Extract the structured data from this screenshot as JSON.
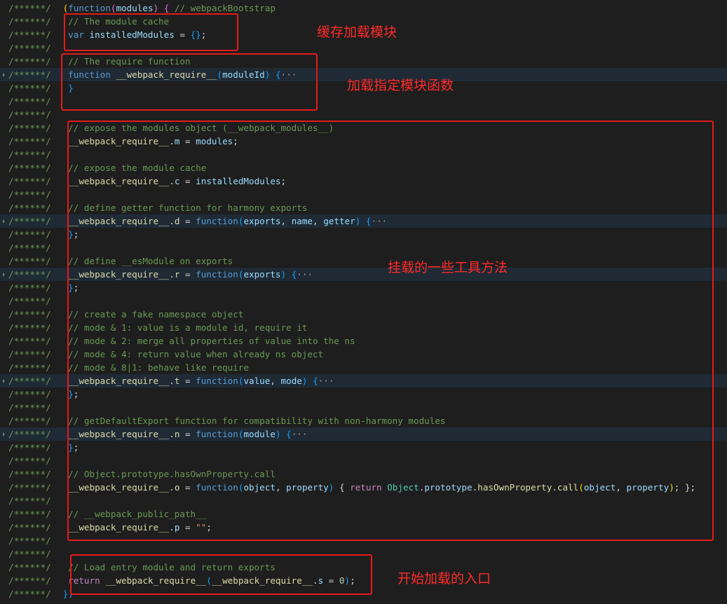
{
  "editor": {
    "gutter_marker": "/******/",
    "fold_icon": "chevron-right-icon",
    "lines": [
      {
        "fold": false,
        "hl": false,
        "tokens": [
          [
            "pn",
            " "
          ],
          [
            "br",
            "("
          ],
          [
            "kw",
            "function"
          ],
          [
            "bp",
            "("
          ],
          [
            "id",
            "modules"
          ],
          [
            "bp",
            ")"
          ],
          [
            "pn",
            " "
          ],
          [
            "bp",
            "{"
          ],
          [
            "pn",
            " "
          ],
          [
            "cm",
            "// webpackBootstrap"
          ]
        ]
      },
      {
        "fold": false,
        "hl": false,
        "tokens": [
          [
            "cm",
            "  // The module cache"
          ]
        ]
      },
      {
        "fold": false,
        "hl": false,
        "tokens": [
          [
            "pn",
            "  "
          ],
          [
            "kw",
            "var"
          ],
          [
            "pn",
            " "
          ],
          [
            "id",
            "installedModules"
          ],
          [
            "pn",
            " = "
          ],
          [
            "bb",
            "{}"
          ],
          [
            "pn",
            ";"
          ]
        ]
      },
      {
        "fold": false,
        "hl": false,
        "tokens": []
      },
      {
        "fold": false,
        "hl": false,
        "tokens": [
          [
            "cm",
            "  // The require function"
          ]
        ]
      },
      {
        "fold": true,
        "hl": true,
        "tokens": [
          [
            "pn",
            "  "
          ],
          [
            "kw",
            "function"
          ],
          [
            "pn",
            " "
          ],
          [
            "fn",
            "__webpack_require__"
          ],
          [
            "bb",
            "("
          ],
          [
            "id",
            "moduleId"
          ],
          [
            "bb",
            ")"
          ],
          [
            "pn",
            " "
          ],
          [
            "bb",
            "{"
          ],
          [
            "fd",
            "···"
          ]
        ]
      },
      {
        "fold": false,
        "hl": false,
        "tokens": [
          [
            "pn",
            "  "
          ],
          [
            "bb",
            "}"
          ]
        ]
      },
      {
        "fold": false,
        "hl": false,
        "tokens": []
      },
      {
        "fold": false,
        "hl": false,
        "tokens": []
      },
      {
        "fold": false,
        "hl": false,
        "tokens": [
          [
            "cm",
            "  // expose the modules object (__webpack_modules__)"
          ]
        ]
      },
      {
        "fold": false,
        "hl": false,
        "tokens": [
          [
            "pn",
            "  "
          ],
          [
            "fn",
            "__webpack_require__"
          ],
          [
            "pn",
            "."
          ],
          [
            "id",
            "m"
          ],
          [
            "pn",
            " = "
          ],
          [
            "id",
            "modules"
          ],
          [
            "pn",
            ";"
          ]
        ]
      },
      {
        "fold": false,
        "hl": false,
        "tokens": []
      },
      {
        "fold": false,
        "hl": false,
        "tokens": [
          [
            "cm",
            "  // expose the module cache"
          ]
        ]
      },
      {
        "fold": false,
        "hl": false,
        "tokens": [
          [
            "pn",
            "  "
          ],
          [
            "fn",
            "__webpack_require__"
          ],
          [
            "pn",
            "."
          ],
          [
            "id",
            "c"
          ],
          [
            "pn",
            " = "
          ],
          [
            "id",
            "installedModules"
          ],
          [
            "pn",
            ";"
          ]
        ]
      },
      {
        "fold": false,
        "hl": false,
        "tokens": []
      },
      {
        "fold": false,
        "hl": false,
        "tokens": [
          [
            "cm",
            "  // define getter function for harmony exports"
          ]
        ]
      },
      {
        "fold": true,
        "hl": true,
        "tokens": [
          [
            "pn",
            "  "
          ],
          [
            "fn",
            "__webpack_require__"
          ],
          [
            "pn",
            "."
          ],
          [
            "fn",
            "d"
          ],
          [
            "pn",
            " = "
          ],
          [
            "kw",
            "function"
          ],
          [
            "bb",
            "("
          ],
          [
            "id",
            "exports"
          ],
          [
            "pn",
            ", "
          ],
          [
            "id",
            "name"
          ],
          [
            "pn",
            ", "
          ],
          [
            "id",
            "getter"
          ],
          [
            "bb",
            ")"
          ],
          [
            "pn",
            " "
          ],
          [
            "bb",
            "{"
          ],
          [
            "fd",
            "···"
          ]
        ]
      },
      {
        "fold": false,
        "hl": false,
        "tokens": [
          [
            "pn",
            "  "
          ],
          [
            "bb",
            "}"
          ],
          [
            "pn",
            ";"
          ]
        ]
      },
      {
        "fold": false,
        "hl": false,
        "tokens": []
      },
      {
        "fold": false,
        "hl": false,
        "tokens": [
          [
            "cm",
            "  // define __esModule on exports"
          ]
        ]
      },
      {
        "fold": true,
        "hl": true,
        "tokens": [
          [
            "pn",
            "  "
          ],
          [
            "fn",
            "__webpack_require__"
          ],
          [
            "pn",
            "."
          ],
          [
            "fn",
            "r"
          ],
          [
            "pn",
            " = "
          ],
          [
            "kw",
            "function"
          ],
          [
            "bb",
            "("
          ],
          [
            "id",
            "exports"
          ],
          [
            "bb",
            ")"
          ],
          [
            "pn",
            " "
          ],
          [
            "bb",
            "{"
          ],
          [
            "fd",
            "···"
          ]
        ]
      },
      {
        "fold": false,
        "hl": false,
        "tokens": [
          [
            "pn",
            "  "
          ],
          [
            "bb",
            "}"
          ],
          [
            "pn",
            ";"
          ]
        ]
      },
      {
        "fold": false,
        "hl": false,
        "tokens": []
      },
      {
        "fold": false,
        "hl": false,
        "tokens": [
          [
            "cm",
            "  // create a fake namespace object"
          ]
        ]
      },
      {
        "fold": false,
        "hl": false,
        "tokens": [
          [
            "cm",
            "  // mode & 1: value is a module id, require it"
          ]
        ]
      },
      {
        "fold": false,
        "hl": false,
        "tokens": [
          [
            "cm",
            "  // mode & 2: merge all properties of value into the ns"
          ]
        ]
      },
      {
        "fold": false,
        "hl": false,
        "tokens": [
          [
            "cm",
            "  // mode & 4: return value when already ns object"
          ]
        ]
      },
      {
        "fold": false,
        "hl": false,
        "tokens": [
          [
            "cm",
            "  // mode & 8|1: behave like require"
          ]
        ]
      },
      {
        "fold": true,
        "hl": true,
        "tokens": [
          [
            "pn",
            "  "
          ],
          [
            "fn",
            "__webpack_require__"
          ],
          [
            "pn",
            "."
          ],
          [
            "fn",
            "t"
          ],
          [
            "pn",
            " = "
          ],
          [
            "kw",
            "function"
          ],
          [
            "bb",
            "("
          ],
          [
            "id",
            "value"
          ],
          [
            "pn",
            ", "
          ],
          [
            "id",
            "mode"
          ],
          [
            "bb",
            ")"
          ],
          [
            "pn",
            " "
          ],
          [
            "bb",
            "{"
          ],
          [
            "fd",
            "···"
          ]
        ]
      },
      {
        "fold": false,
        "hl": false,
        "tokens": [
          [
            "pn",
            "  "
          ],
          [
            "bb",
            "}"
          ],
          [
            "pn",
            ";"
          ]
        ]
      },
      {
        "fold": false,
        "hl": false,
        "tokens": []
      },
      {
        "fold": false,
        "hl": false,
        "tokens": [
          [
            "cm",
            "  // getDefaultExport function for compatibility with non-harmony modules"
          ]
        ]
      },
      {
        "fold": true,
        "hl": true,
        "tokens": [
          [
            "pn",
            "  "
          ],
          [
            "fn",
            "__webpack_require__"
          ],
          [
            "pn",
            "."
          ],
          [
            "fn",
            "n"
          ],
          [
            "pn",
            " = "
          ],
          [
            "kw",
            "function"
          ],
          [
            "bb",
            "("
          ],
          [
            "id",
            "module"
          ],
          [
            "bb",
            ")"
          ],
          [
            "pn",
            " "
          ],
          [
            "bb",
            "{"
          ],
          [
            "fd",
            "···"
          ]
        ]
      },
      {
        "fold": false,
        "hl": false,
        "tokens": [
          [
            "pn",
            "  "
          ],
          [
            "bb",
            "}"
          ],
          [
            "pn",
            ";"
          ]
        ]
      },
      {
        "fold": false,
        "hl": false,
        "tokens": []
      },
      {
        "fold": false,
        "hl": false,
        "tokens": [
          [
            "cm",
            "  // Object.prototype.hasOwnProperty.call"
          ]
        ]
      },
      {
        "fold": false,
        "hl": false,
        "tokens": [
          [
            "pn",
            "  "
          ],
          [
            "fn",
            "__webpack_require__"
          ],
          [
            "pn",
            "."
          ],
          [
            "fn",
            "o"
          ],
          [
            "pn",
            " = "
          ],
          [
            "kw",
            "function"
          ],
          [
            "bb",
            "("
          ],
          [
            "id",
            "object"
          ],
          [
            "pn",
            ", "
          ],
          [
            "id",
            "property"
          ],
          [
            "bb",
            ")"
          ],
          [
            "pn",
            " { "
          ],
          [
            "ctl",
            "return"
          ],
          [
            "pn",
            " "
          ],
          [
            "cls",
            "Object"
          ],
          [
            "pn",
            "."
          ],
          [
            "id",
            "prototype"
          ],
          [
            "pn",
            "."
          ],
          [
            "fn",
            "hasOwnProperty"
          ],
          [
            "pn",
            "."
          ],
          [
            "fn",
            "call"
          ],
          [
            "br",
            "("
          ],
          [
            "id",
            "object"
          ],
          [
            "pn",
            ", "
          ],
          [
            "id",
            "property"
          ],
          [
            "br",
            ")"
          ],
          [
            "pn",
            "; };"
          ]
        ]
      },
      {
        "fold": false,
        "hl": false,
        "tokens": []
      },
      {
        "fold": false,
        "hl": false,
        "tokens": [
          [
            "cm",
            "  // __webpack_public_path__"
          ]
        ]
      },
      {
        "fold": false,
        "hl": false,
        "tokens": [
          [
            "pn",
            "  "
          ],
          [
            "fn",
            "__webpack_require__"
          ],
          [
            "pn",
            "."
          ],
          [
            "id",
            "p"
          ],
          [
            "pn",
            " = "
          ],
          [
            "str",
            "\"\""
          ],
          [
            "pn",
            ";"
          ]
        ]
      },
      {
        "fold": false,
        "hl": false,
        "tokens": []
      },
      {
        "fold": false,
        "hl": false,
        "tokens": []
      },
      {
        "fold": false,
        "hl": false,
        "tokens": [
          [
            "cm",
            "  // Load entry module and return exports"
          ]
        ]
      },
      {
        "fold": false,
        "hl": false,
        "tokens": [
          [
            "pn",
            "  "
          ],
          [
            "ctl",
            "return"
          ],
          [
            "pn",
            " "
          ],
          [
            "fn",
            "__webpack_require__"
          ],
          [
            "bb",
            "("
          ],
          [
            "fn",
            "__webpack_require__"
          ],
          [
            "pn",
            "."
          ],
          [
            "id",
            "s"
          ],
          [
            "pn",
            " = "
          ],
          [
            "num",
            "0"
          ],
          [
            "bb",
            ")"
          ],
          [
            "pn",
            ";"
          ]
        ]
      },
      {
        "fold": false,
        "hl": false,
        "tokens": [
          [
            "pn",
            " "
          ],
          [
            "bb",
            "})"
          ]
        ]
      }
    ]
  },
  "annotations": {
    "cache": "缓存加载模块",
    "require": "加载指定模块函数",
    "utils": "挂载的一些工具方法",
    "entry": "开始加载的入口"
  }
}
